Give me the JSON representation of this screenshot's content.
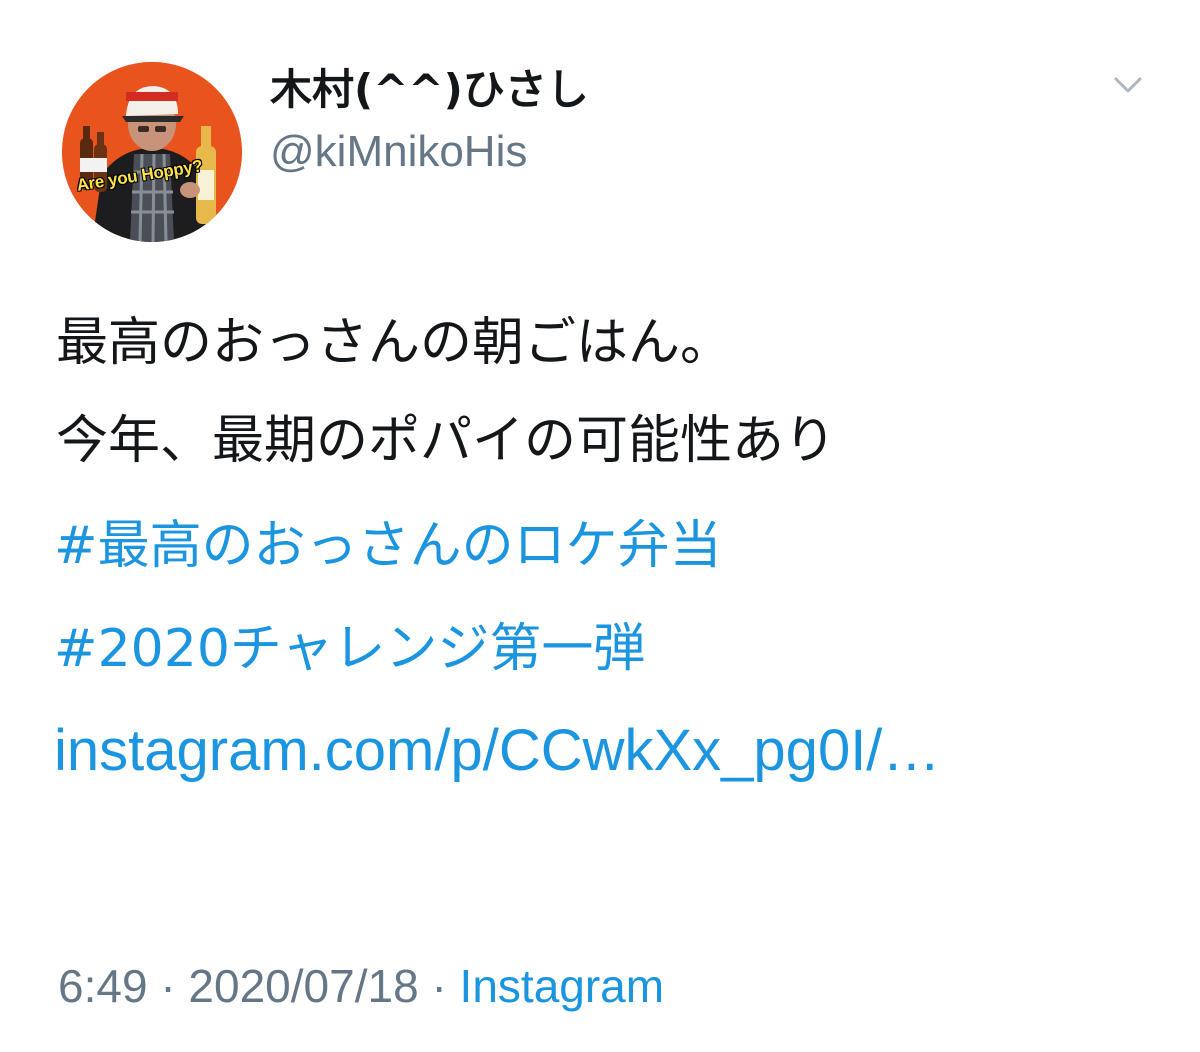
{
  "author": {
    "display_name": "木村(^^)ひさし",
    "handle": "@kiMnikoHis",
    "avatar_caption": "Are you Hoppy?"
  },
  "icons": {
    "menu": "chevron-down-icon"
  },
  "tweet": {
    "lines": [
      "最高のおっさんの朝ごはん。",
      "今年、最期のポパイの可能性あり"
    ],
    "hashtags": [
      "#最高のおっさんのロケ弁当",
      "#2020チャレンジ第一弾"
    ],
    "link": "instagram.com/p/CCwkXx_pg0I/…"
  },
  "meta": {
    "time": "6:49",
    "separator": "·",
    "date": "2020/07/18",
    "source": "Instagram"
  },
  "colors": {
    "text": "#14171a",
    "secondary": "#657786",
    "link": "#1b95e0",
    "avatar_bg": "#e8531e"
  }
}
